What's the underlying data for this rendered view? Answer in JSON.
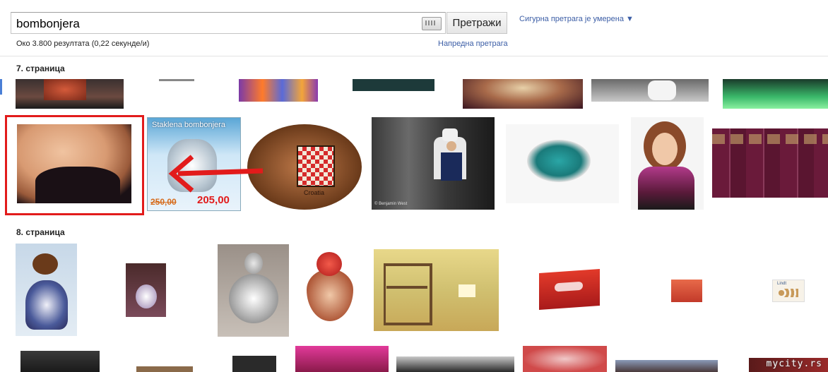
{
  "search": {
    "query": "bombonjera",
    "button_label": "Претражи",
    "safesearch_label": "Сигурна претрага је умерена ▼",
    "result_stats": "Око 3.800 резултата (0,22 секунде/и)",
    "advanced_link": "Напредна претрага"
  },
  "pages": {
    "page7_label": "7. страница",
    "page8_label": "8. страница"
  },
  "thumbnails": {
    "glass_caption": "Staklena bombonjera",
    "glass_old_price": "250,00",
    "glass_new_price": "205,00",
    "box_caption": "Croatia",
    "chef_caption": "© Benjamin West",
    "lindt_caption": "Lindt"
  },
  "watermark": "mycity.rs",
  "colors": {
    "link": "#3c5ea6",
    "highlight": "#e21b1b"
  }
}
